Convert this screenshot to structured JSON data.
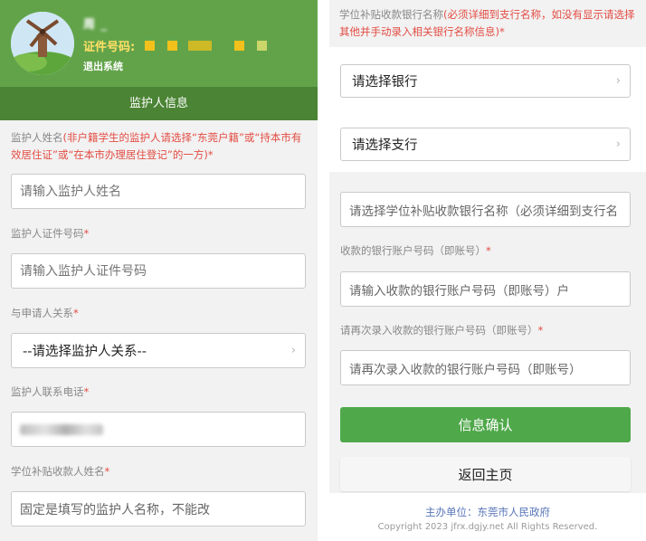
{
  "header": {
    "username": "周 _",
    "cert_label": "证件号码:",
    "logout": "退出系统",
    "tab": "监护人信息"
  },
  "left": {
    "guardian_name": {
      "label": "监护人姓名",
      "note": "(非户籍学生的监护人请选择“东莞户籍”或“持本市有效居住证”或“在本市办理居住登记”的一方)",
      "star": "*",
      "placeholder": "请输入监护人姓名"
    },
    "guardian_id": {
      "label": "监护人证件号码",
      "star": "*",
      "placeholder": "请输入监护人证件号码"
    },
    "relation": {
      "label": "与申请人关系",
      "star": "*",
      "value": "--请选择监护人关系--"
    },
    "phone": {
      "label": "监护人联系电话",
      "star": "*"
    },
    "payee": {
      "label": "学位补贴收款人姓名",
      "star": "*",
      "value": "固定是填写的监护人名称，不能改"
    }
  },
  "right": {
    "bank_name": {
      "label": "学位补贴收款银行名称",
      "note": "(必须详细到支行名称，如没有显示请选择其他并手动录入相关银行名称信息)",
      "star": "*"
    },
    "bank_select": "请选择银行",
    "branch_select": "请选择支行",
    "bank_input": "请选择学位补贴收款银行名称（必须详细到支行名",
    "account": {
      "label": "收款的银行账户号码（即账号）",
      "star": "*",
      "placeholder": "请输入收款的银行账户号码（即账号）户"
    },
    "account_confirm": {
      "label": "请再次录入收款的银行账户号码（即账号）",
      "star": "*",
      "placeholder": "请再次录入收款的银行账户号码（即账号）"
    },
    "confirm_button": "信息确认",
    "home_button": "返回主页",
    "footer_org": "主办单位：东莞市人民政府",
    "footer_copy": "Copyright 2023 jfrx.dgjy.net All Rights Reserved."
  },
  "colors": {
    "header_green": "#62a34a",
    "tab_green": "#4a8434",
    "button_green": "#4fa84a",
    "required_red": "#e34c43"
  },
  "icons": {
    "select_arrow": "chevron-right-icon",
    "avatar": "windmill-avatar-icon"
  }
}
